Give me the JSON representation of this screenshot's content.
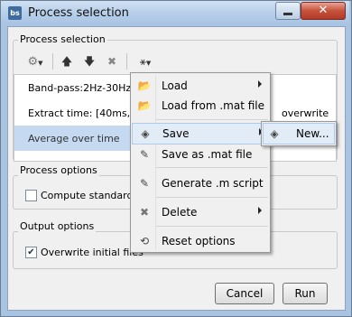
{
  "window": {
    "title": "Process selection",
    "app_icon_text": "bs",
    "minimize_icon": "minimize-icon",
    "close_icon": "close-icon",
    "close_glyph": "✕"
  },
  "process_selection": {
    "group_title": "Process selection",
    "toolbar": {
      "gear_icon": "gear-icon",
      "move_up_icon": "arrow-up-icon",
      "move_down_icon": "arrow-down-icon",
      "delete_icon": "delete-icon",
      "pipeline_icon": "pipeline-icon"
    },
    "items": [
      {
        "label": "Band-pass:2Hz-30Hz"
      },
      {
        "label": "Extract time: [40ms,50m"
      },
      {
        "label": "Average over time"
      }
    ],
    "trailing_text": "overwrite"
  },
  "process_options": {
    "group_title": "Process options",
    "compute_label": "Compute standard",
    "compute_checked": false
  },
  "output_options": {
    "group_title": "Output options",
    "overwrite_label": "Overwrite initial files",
    "overwrite_checked": true
  },
  "buttons": {
    "cancel": "Cancel",
    "run": "Run"
  },
  "context_menu": {
    "items": [
      {
        "label": "Load",
        "icon": "folder-open-icon",
        "has_submenu": true
      },
      {
        "label": "Load from .mat file",
        "icon": "folder-open-icon",
        "has_submenu": false
      },
      {
        "label": "Save",
        "icon": "save-icon",
        "has_submenu": true,
        "highlighted": true
      },
      {
        "label": "Save as .mat file",
        "icon": "pen-icon",
        "has_submenu": false
      },
      {
        "label": "Generate .m script",
        "icon": "pen-icon",
        "has_submenu": false
      },
      {
        "label": "Delete",
        "icon": "delete-icon",
        "has_submenu": true
      },
      {
        "label": "Reset options",
        "icon": "reset-icon",
        "has_submenu": false
      }
    ],
    "submenu": {
      "label": "New...",
      "icon": "save-icon"
    }
  },
  "colors": {
    "selection": "#c5d9f1",
    "menu_highlight": "#e2ecf7",
    "title_bar": "#b4cde9"
  }
}
